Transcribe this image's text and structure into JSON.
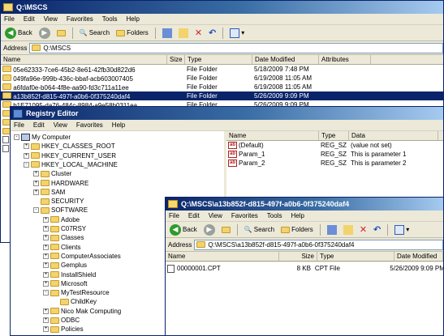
{
  "bg_explorer": {
    "title": "Q:\\MSCS",
    "menu": [
      "File",
      "Edit",
      "View",
      "Favorites",
      "Tools",
      "Help"
    ],
    "toolbar": {
      "back": "Back",
      "search": "Search",
      "folders": "Folders"
    },
    "address_label": "Address",
    "address_value": "Q:\\MSCS",
    "columns": [
      "Name",
      "Size",
      "Type",
      "Date Modified",
      "Attributes"
    ],
    "rows": [
      {
        "name": "05e62333-7ce6-45b2-8e61-42fb30d822d6",
        "size": "",
        "type": "File Folder",
        "date": "5/18/2009 7:48 PM",
        "selected": false
      },
      {
        "name": "049fa96e-999b-436c-bbaf-acb603007405",
        "size": "",
        "type": "File Folder",
        "date": "6/19/2008 11:05 AM",
        "selected": false
      },
      {
        "name": "a6fdaf0e-b064-4f8e-aa90-fd3c711a11ee",
        "size": "",
        "type": "File Folder",
        "date": "6/19/2008 11:05 AM",
        "selected": false
      },
      {
        "name": "a13b852f-d815-497f-a0b6-0f375240daf4",
        "size": "",
        "type": "File Folder",
        "date": "5/26/2009 9:09 PM",
        "selected": true
      },
      {
        "name": "b1E71095-da76-484c-8984-a9e58b0311ea",
        "size": "",
        "type": "File Folder",
        "date": "5/26/2009 9:09 PM",
        "selected": false
      }
    ],
    "partial_names": [
      "ca",
      "eb",
      "fb",
      "ch",
      "qu"
    ]
  },
  "regedit": {
    "title": "Registry Editor",
    "menu": [
      "File",
      "Edit",
      "View",
      "Favorites",
      "Help"
    ],
    "tree": [
      {
        "label": "My Computer",
        "level": 0,
        "expander": "-"
      },
      {
        "label": "HKEY_CLASSES_ROOT",
        "level": 1,
        "expander": "+"
      },
      {
        "label": "HKEY_CURRENT_USER",
        "level": 1,
        "expander": "+"
      },
      {
        "label": "HKEY_LOCAL_MACHINE",
        "level": 1,
        "expander": "-"
      },
      {
        "label": "Cluster",
        "level": 2,
        "expander": "+"
      },
      {
        "label": "HARDWARE",
        "level": 2,
        "expander": "+"
      },
      {
        "label": "SAM",
        "level": 2,
        "expander": "+"
      },
      {
        "label": "SECURITY",
        "level": 2,
        "expander": ""
      },
      {
        "label": "SOFTWARE",
        "level": 2,
        "expander": "-"
      },
      {
        "label": "Adobe",
        "level": 3,
        "expander": "+"
      },
      {
        "label": "C07RSY",
        "level": 3,
        "expander": "+"
      },
      {
        "label": "Classes",
        "level": 3,
        "expander": "+"
      },
      {
        "label": "Clients",
        "level": 3,
        "expander": "+"
      },
      {
        "label": "ComputerAssociates",
        "level": 3,
        "expander": "+"
      },
      {
        "label": "Gemplus",
        "level": 3,
        "expander": "+"
      },
      {
        "label": "InstallShield",
        "level": 3,
        "expander": "+"
      },
      {
        "label": "Microsoft",
        "level": 3,
        "expander": "+"
      },
      {
        "label": "MyTestResource",
        "level": 3,
        "expander": "-"
      },
      {
        "label": "ChildKey",
        "level": 4,
        "expander": ""
      },
      {
        "label": "Nico Mak Computing",
        "level": 3,
        "expander": "+"
      },
      {
        "label": "ODBC",
        "level": 3,
        "expander": "+"
      },
      {
        "label": "Policies",
        "level": 3,
        "expander": "+"
      },
      {
        "label": "Program Groups",
        "level": 3,
        "expander": ""
      }
    ],
    "value_columns": [
      "Name",
      "Type",
      "Data"
    ],
    "values": [
      {
        "name": "(Default)",
        "type": "REG_SZ",
        "data": "(value not set)"
      },
      {
        "name": "Param_1",
        "type": "REG_SZ",
        "data": "This is parameter 1"
      },
      {
        "name": "Param_2",
        "type": "REG_SZ",
        "data": "This is parameter 2"
      }
    ]
  },
  "fg_explorer": {
    "title": "Q:\\MSCS\\a13b852f-d815-497f-a0b6-0f375240daf4",
    "menu": [
      "File",
      "Edit",
      "View",
      "Favorites",
      "Tools",
      "Help"
    ],
    "toolbar": {
      "back": "Back",
      "search": "Search",
      "folders": "Folders"
    },
    "address_label": "Address",
    "address_value": "Q:\\MSCS\\a13b852f-d815-497f-a0b6-0f375240daf4",
    "columns": [
      "Name",
      "Size",
      "Type",
      "Date Modified"
    ],
    "rows": [
      {
        "name": "00000001.CPT",
        "size": "8 KB",
        "type": "CPT File",
        "date": "5/26/2009 9:09 PM"
      }
    ]
  }
}
